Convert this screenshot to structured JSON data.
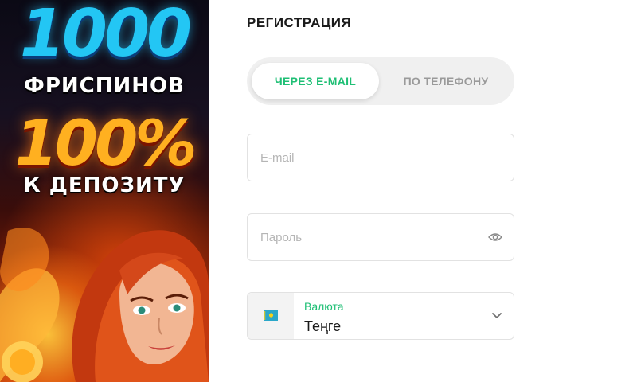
{
  "promo": {
    "headline_number": "1000",
    "headline_text": "ФРИСПИНОВ",
    "bonus_percent": "100%",
    "bonus_text": "К ДЕПОЗИТУ"
  },
  "form": {
    "title": "РЕГИСТРАЦИЯ",
    "tabs": [
      {
        "label": "ЧЕРЕЗ E-MAIL",
        "active": true
      },
      {
        "label": "ПО ТЕЛЕФОНУ",
        "active": false
      }
    ],
    "email": {
      "placeholder": "E-mail",
      "value": ""
    },
    "password": {
      "placeholder": "Пароль",
      "value": "",
      "icon": "eye-icon"
    },
    "currency": {
      "label": "Валюта",
      "value": "Теңге",
      "flag_icon": "kazakhstan-flag-icon",
      "chevron_icon": "chevron-down-icon"
    }
  },
  "colors": {
    "accent": "#1fbf75",
    "tab_bg": "#f0f0f0",
    "border": "#e2e2e2",
    "muted_text": "#9a9a9a"
  }
}
